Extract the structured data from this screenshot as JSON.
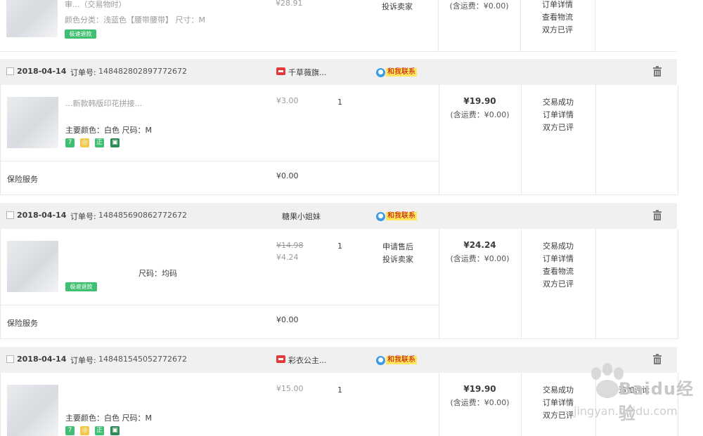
{
  "top_fragment": {
    "line1": "审...（交易物时）",
    "line2": "颜色分类：浅蓝色【腰带腰带】  尺寸：M",
    "price": "¥28.91",
    "link": "投诉卖家",
    "shipping": "(含运费：¥0.00)",
    "actions": [
      "订单详情",
      "查看物流",
      "双方已评"
    ]
  },
  "orders": [
    {
      "date": "2018-04-14",
      "order_no_label": "订单号:",
      "order_no": "148482802897772672",
      "shop": "千草薇旗...",
      "chat_label": "和我联系",
      "item_title": "...新款韩版印花拼接...",
      "item_attrs": "主要颜色：白色  尺码：M",
      "unit_price": "¥3.00",
      "qty": "1",
      "total": "¥19.90",
      "shipping": "(含运费：¥0.00)",
      "actions": [
        "交易成功",
        "订单详情",
        "双方已评"
      ],
      "insurance_label": "保险服务",
      "insurance_price": "¥0.00"
    },
    {
      "date": "2018-04-14",
      "order_no_label": "订单号:",
      "order_no": "148485690862772672",
      "shop": "糖果小姐妹",
      "chat_label": "和我联系",
      "item_attrs": "尺码：均码",
      "unit_price": "¥14.98",
      "unit_price_new": "¥4.24",
      "qty": "1",
      "links": [
        "申请售后",
        "投诉卖家"
      ],
      "total": "¥24.24",
      "shipping": "(含运费：¥0.00)",
      "actions": [
        "交易成功",
        "订单详情",
        "查看物流",
        "双方已评"
      ],
      "insurance_label": "保险服务",
      "insurance_price": "¥0.00"
    },
    {
      "date": "2018-04-14",
      "order_no_label": "订单号:",
      "order_no": "148481545052772672",
      "shop": "彩衣公主...",
      "chat_label": "和我联系",
      "item_attrs": "主要颜色：白色  尺码：M",
      "unit_price": "¥15.00",
      "qty": "1",
      "total": "¥19.90",
      "shipping": "(含运费：¥0.00)",
      "actions": [
        "交易成功",
        "订单详情",
        "双方已评"
      ],
      "extra_action": "追加评论"
    }
  ],
  "badges": {
    "label_7": "7",
    "label_zheng": "正",
    "label_ship": "极速退款"
  },
  "watermark": {
    "brand": "Baidu经验",
    "url": "jingyan.baidu.com"
  },
  "colors": {
    "header_bg": "#f0f0f0",
    "chat_bg": "#ffe55c",
    "chat_text": "#c40000",
    "badge_green": "#3fbf71",
    "badge_yellow": "#f2c94c"
  }
}
